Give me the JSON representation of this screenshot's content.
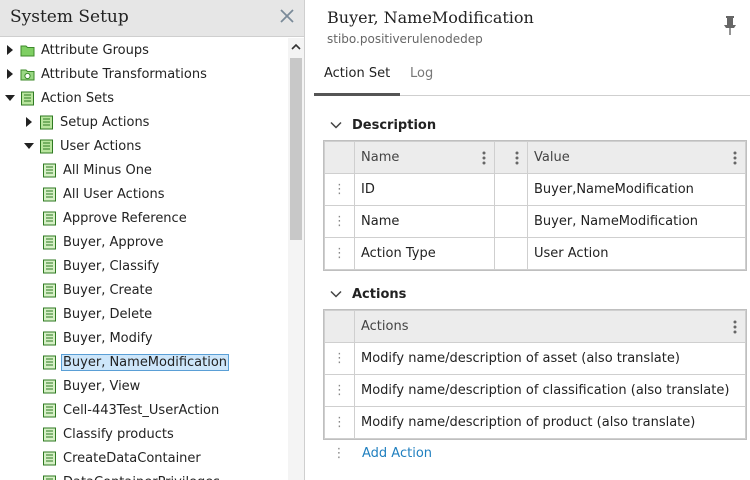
{
  "left_panel": {
    "title": "System Setup",
    "tree": [
      {
        "label": "Attribute Groups",
        "expanded": false,
        "icon": "folder-icon"
      },
      {
        "label": "Attribute Transformations",
        "expanded": false,
        "icon": "transform-icon"
      },
      {
        "label": "Action Sets",
        "expanded": true,
        "icon": "action-set-icon"
      },
      {
        "label": "Setup Actions",
        "expanded": false,
        "icon": "action-set-icon"
      },
      {
        "label": "User Actions",
        "expanded": true,
        "icon": "action-set-icon"
      },
      {
        "label": "All Minus One",
        "icon": "action-icon"
      },
      {
        "label": "All User Actions",
        "icon": "action-icon"
      },
      {
        "label": "Approve Reference",
        "icon": "action-icon"
      },
      {
        "label": "Buyer, Approve",
        "icon": "action-icon"
      },
      {
        "label": "Buyer, Classify",
        "icon": "action-icon"
      },
      {
        "label": "Buyer, Create",
        "icon": "action-icon"
      },
      {
        "label": "Buyer, Delete",
        "icon": "action-icon"
      },
      {
        "label": "Buyer, Modify",
        "icon": "action-icon"
      },
      {
        "label": "Buyer, NameModification",
        "icon": "action-icon",
        "selected": true
      },
      {
        "label": "Buyer, View",
        "icon": "action-icon"
      },
      {
        "label": "Cell-443Test_UserAction",
        "icon": "action-icon"
      },
      {
        "label": "Classify products",
        "icon": "action-icon"
      },
      {
        "label": "CreateDataContainer",
        "icon": "action-icon"
      },
      {
        "label": "DataContainerPrivileges",
        "icon": "action-icon"
      }
    ]
  },
  "detail": {
    "title": "Buyer, NameModification",
    "subtitle": "stibo.positiverulenodedep",
    "tabs": [
      "Action Set",
      "Log"
    ],
    "description_section": {
      "title": "Description",
      "columns": [
        "Name",
        "Value"
      ],
      "rows": [
        {
          "name": "ID",
          "value": "Buyer,NameModification"
        },
        {
          "name": "Name",
          "value": "Buyer, NameModification"
        },
        {
          "name": "Action Type",
          "value": "User Action"
        }
      ]
    },
    "actions_section": {
      "title": "Actions",
      "column": "Actions",
      "rows": [
        "Modify name/description of asset (also translate)",
        "Modify name/description of classification (also translate)",
        "Modify name/description of product (also translate)"
      ],
      "add_label": "Add Action"
    }
  },
  "colors": {
    "selection_bg": "#cde6fa",
    "selection_border": "#5a9fd6",
    "link": "#1f7fbf",
    "header_bg": "#e6e6e6"
  }
}
